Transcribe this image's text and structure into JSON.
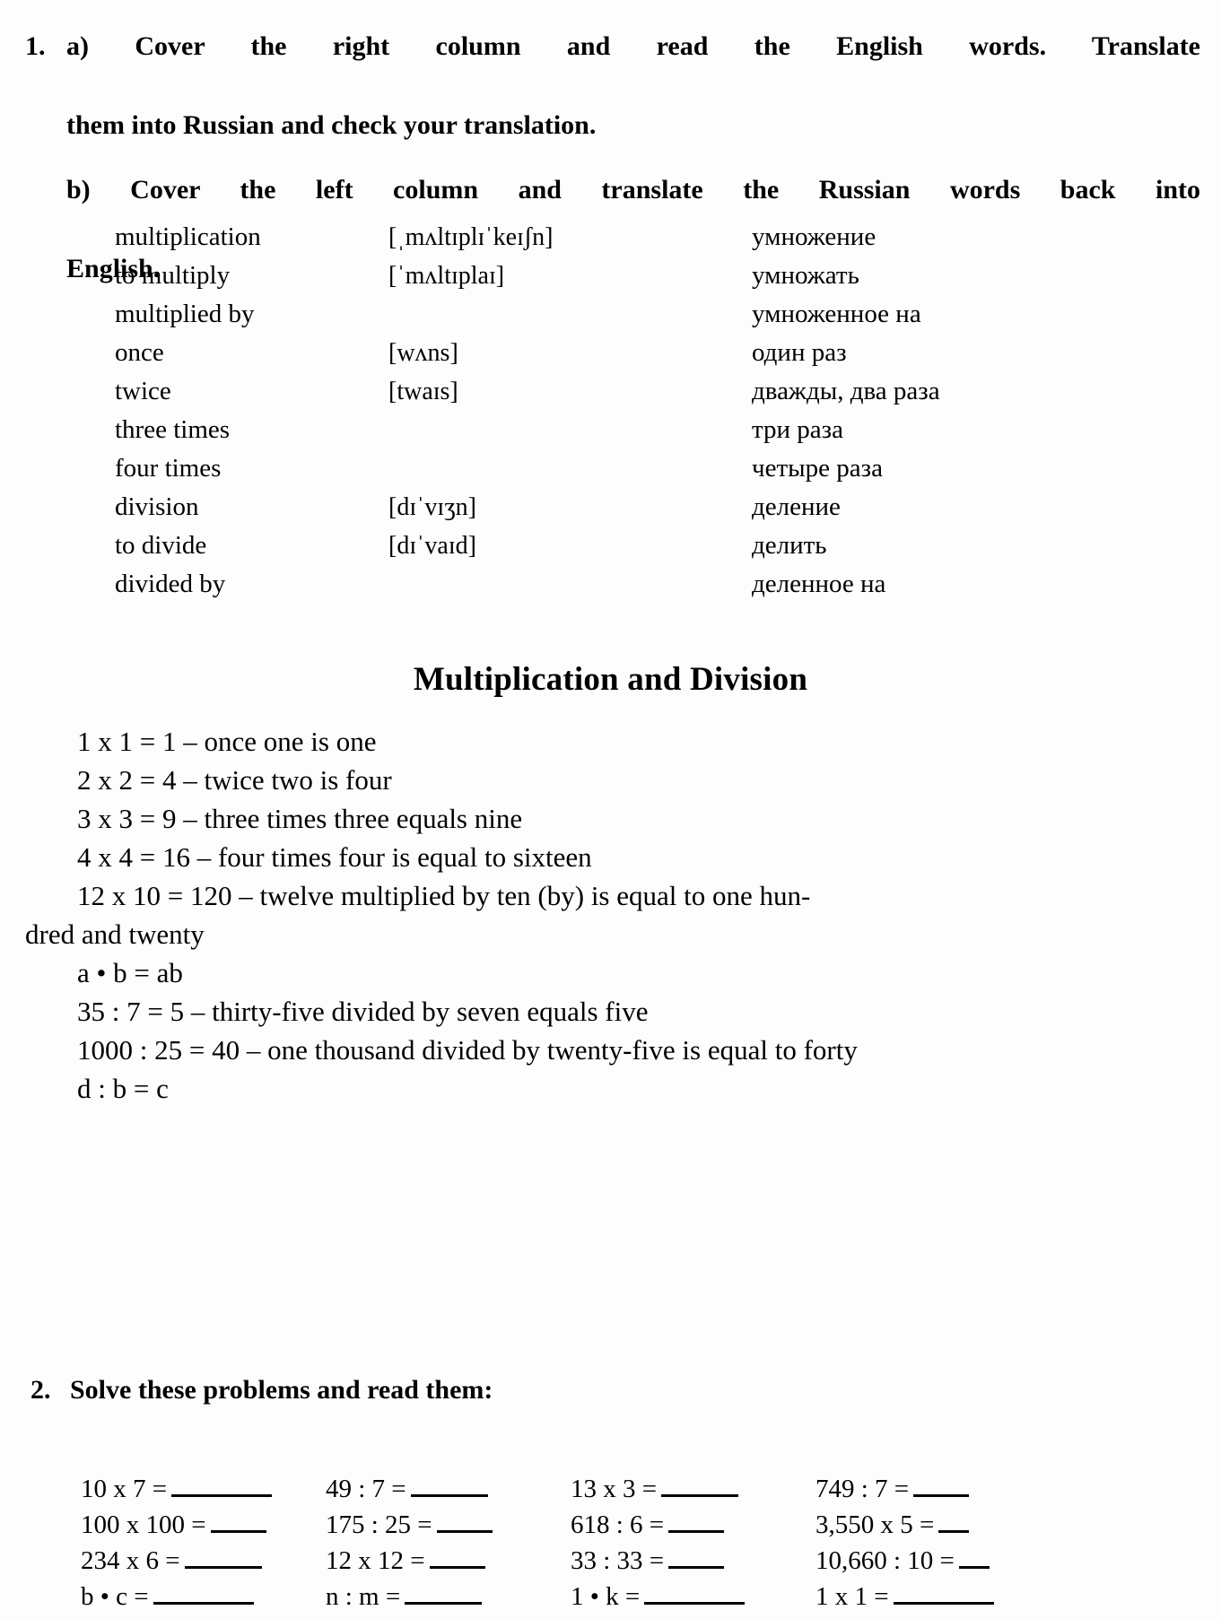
{
  "exercise1": {
    "number": "1.",
    "part_a": "a) Cover the right column and read the English words. Translate them into Russian and check your translation.",
    "part_a_line1": "a) Cover the right column and read the English words. Translate",
    "part_a_line2": "them into Russian and check your translation.",
    "part_b_line1": "b) Cover the left column and translate the Russian words back into",
    "part_b_line2": "English."
  },
  "vocabulary": [
    {
      "english": "multiplication",
      "ipa": "[ˌmʌltɪplɪˈkeɪʃn]",
      "russian": "умножение"
    },
    {
      "english": "to multiply",
      "ipa": "[ˈmʌltɪplaɪ]",
      "russian": "умножать"
    },
    {
      "english": "multiplied by",
      "ipa": "",
      "russian": "умноженное на"
    },
    {
      "english": "once",
      "ipa": "[wʌns]",
      "russian": "один раз"
    },
    {
      "english": "twice",
      "ipa": "[twaɪs]",
      "russian": "дважды, два раза"
    },
    {
      "english": "three times",
      "ipa": "",
      "russian": "три раза"
    },
    {
      "english": "four times",
      "ipa": "",
      "russian": "четыре раза"
    },
    {
      "english": "division",
      "ipa": "[dɪˈvɪʒn]",
      "russian": "деление"
    },
    {
      "english": "to divide",
      "ipa": "[dɪˈvaɪd]",
      "russian": "делить"
    },
    {
      "english": "divided by",
      "ipa": "",
      "russian": "деленное на"
    }
  ],
  "section_title": "Multiplication and Division",
  "math_examples": [
    "1 x 1 = 1 – once one is one",
    "2 x 2 = 4 – twice two is four",
    "3 x 3 = 9 – three times three equals nine",
    "4 x 4 = 16 – four times four is equal to sixteen",
    "12 x 10 = 120 – twelve multiplied by ten (by) is equal to one hun-",
    "dred and twenty",
    "a • b = ab",
    "35 : 7 = 5 – thirty-five divided by seven equals five",
    "1000 : 25 = 40 – one thousand divided by twenty-five is equal to forty",
    "d : b = c"
  ],
  "exercise2": {
    "number": "2.",
    "title": "Solve these problems and read them:",
    "rows": [
      [
        {
          "expr": "10 x 7 =",
          "blank": "b-lg"
        },
        {
          "expr": "49 : 7 =",
          "blank": "b-md"
        },
        {
          "expr": "13 x 3 =",
          "blank": "b-md"
        },
        {
          "expr": "749 : 7 =",
          "blank": "b-sm"
        }
      ],
      [
        {
          "expr": "100 x 100 =",
          "blank": "b-sm"
        },
        {
          "expr": "175 : 25 =",
          "blank": "b-sm"
        },
        {
          "expr": "618 : 6 =",
          "blank": "b-sm"
        },
        {
          "expr": "3,550 x 5 =",
          "blank": "b-xs"
        }
      ],
      [
        {
          "expr": "234 x 6 =",
          "blank": "b-md"
        },
        {
          "expr": "12 x 12 =",
          "blank": "b-sm"
        },
        {
          "expr": "33 : 33 =",
          "blank": "b-sm"
        },
        {
          "expr": "10,660 : 10 =",
          "blank": "b-xs"
        }
      ],
      [
        {
          "expr": "b • c =",
          "blank": "b-lg"
        },
        {
          "expr": "n : m =",
          "blank": "b-md"
        },
        {
          "expr": "1 • k =",
          "blank": "b-lg"
        },
        {
          "expr": "1 x 1 =",
          "blank": "b-lg"
        }
      ]
    ]
  }
}
